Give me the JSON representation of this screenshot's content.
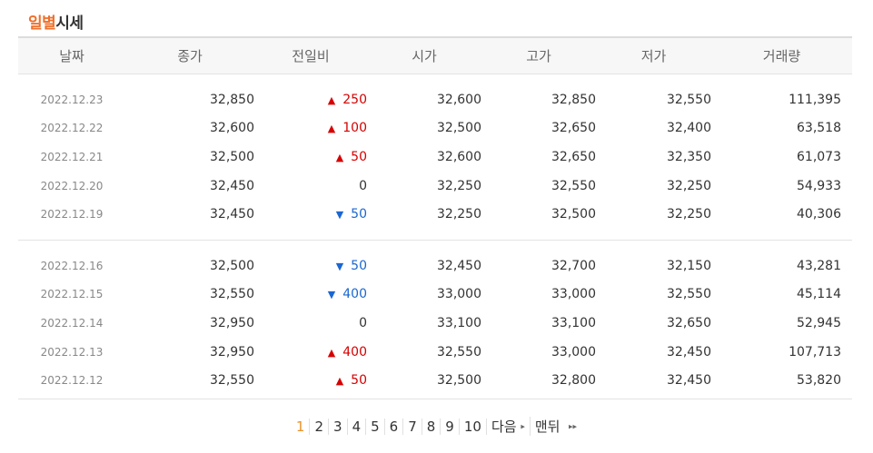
{
  "title": {
    "accent": "일별",
    "rest": "시세"
  },
  "headers": [
    "날짜",
    "종가",
    "전일비",
    "시가",
    "고가",
    "저가",
    "거래량"
  ],
  "groups": [
    [
      {
        "date": "2022.12.23",
        "close": "32,850",
        "dir": "up",
        "diff": "250",
        "open": "32,600",
        "high": "32,850",
        "low": "32,550",
        "vol": "111,395"
      },
      {
        "date": "2022.12.22",
        "close": "32,600",
        "dir": "up",
        "diff": "100",
        "open": "32,500",
        "high": "32,650",
        "low": "32,400",
        "vol": "63,518"
      },
      {
        "date": "2022.12.21",
        "close": "32,500",
        "dir": "up",
        "diff": "50",
        "open": "32,600",
        "high": "32,650",
        "low": "32,350",
        "vol": "61,073"
      },
      {
        "date": "2022.12.20",
        "close": "32,450",
        "dir": "flat",
        "diff": "0",
        "open": "32,250",
        "high": "32,550",
        "low": "32,250",
        "vol": "54,933"
      },
      {
        "date": "2022.12.19",
        "close": "32,450",
        "dir": "down",
        "diff": "50",
        "open": "32,250",
        "high": "32,500",
        "low": "32,250",
        "vol": "40,306"
      }
    ],
    [
      {
        "date": "2022.12.16",
        "close": "32,500",
        "dir": "down",
        "diff": "50",
        "open": "32,450",
        "high": "32,700",
        "low": "32,150",
        "vol": "43,281"
      },
      {
        "date": "2022.12.15",
        "close": "32,550",
        "dir": "down",
        "diff": "400",
        "open": "33,000",
        "high": "33,000",
        "low": "32,550",
        "vol": "45,114"
      },
      {
        "date": "2022.12.14",
        "close": "32,950",
        "dir": "flat",
        "diff": "0",
        "open": "33,100",
        "high": "33,100",
        "low": "32,650",
        "vol": "52,945"
      },
      {
        "date": "2022.12.13",
        "close": "32,950",
        "dir": "up",
        "diff": "400",
        "open": "32,550",
        "high": "33,000",
        "low": "32,450",
        "vol": "107,713"
      },
      {
        "date": "2022.12.12",
        "close": "32,550",
        "dir": "up",
        "diff": "50",
        "open": "32,500",
        "high": "32,800",
        "low": "32,450",
        "vol": "53,820"
      }
    ]
  ],
  "icons": {
    "up": "▲",
    "down": "▼",
    "next": "▸",
    "last": "▸▸"
  },
  "colors": {
    "up": "#d60000",
    "down": "#1a67d2",
    "accent": "#ef6f2a",
    "current_page": "#e8932b"
  },
  "pagination": {
    "pages": [
      "1",
      "2",
      "3",
      "4",
      "5",
      "6",
      "7",
      "8",
      "9",
      "10"
    ],
    "current": "1",
    "next_label": "다음",
    "last_label": "맨뒤"
  }
}
